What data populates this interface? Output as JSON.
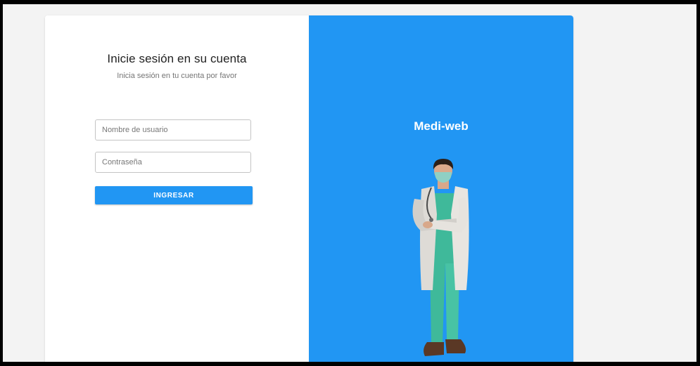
{
  "login": {
    "title": "Inicie sesión en su cuenta",
    "subtitle": "Inicia sesión en tu cuenta por favor",
    "username_placeholder": "Nombre de usuario",
    "password_placeholder": "Contraseña",
    "submit_label": "INGRESAR"
  },
  "brand": {
    "name": "Medi-web"
  },
  "colors": {
    "primary": "#2196f3",
    "background": "#f3f3f3",
    "frame": "#000000"
  }
}
